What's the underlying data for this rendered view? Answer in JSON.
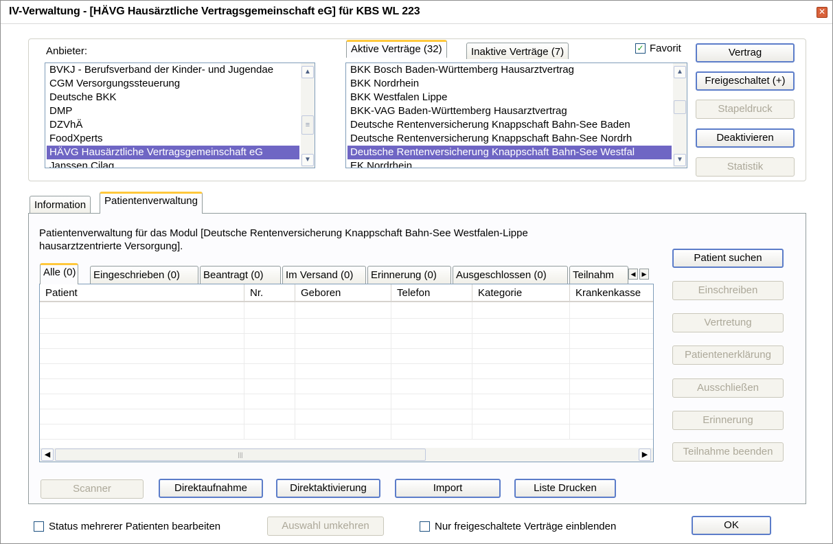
{
  "window": {
    "title": "IV-Verwaltung - [HÄVG Hausärztliche Vertragsgemeinschaft eG] für KBS WL 223",
    "close_glyph": "✕"
  },
  "anbieter": {
    "label": "Anbieter:",
    "items": [
      "BVKJ - Berufsverband der Kinder- und Jugendae",
      "CGM Versorgungssteuerung",
      "Deutsche BKK",
      "DMP",
      "DZVhÄ",
      "FoodXperts",
      "HÄVG Hausärztliche Vertragsgemeinschaft eG",
      "Janssen Cilag"
    ],
    "selected_index": 6
  },
  "vertraege_tabs": {
    "aktive": "Aktive Verträge (32)",
    "inaktive": "Inaktive Verträge (7)"
  },
  "favorit": {
    "label": "Favorit",
    "checked": true,
    "check_glyph": "✓"
  },
  "vertraege": {
    "items": [
      "BKK Bosch Baden-Württemberg Hausarztvertrag",
      "BKK Nordrhein",
      "BKK Westfalen Lippe",
      "BKK-VAG Baden-Württemberg Hausarztvertrag",
      "Deutsche Rentenversicherung Knappschaft Bahn-See Baden",
      "Deutsche Rentenversicherung Knappschaft Bahn-See Nordrh",
      "Deutsche Rentenversicherung Knappschaft Bahn-See Westfal",
      "EK Nordrhein"
    ],
    "selected_index": 6
  },
  "side_buttons_top": {
    "vertrag": "Vertrag",
    "freigeschaltet": "Freigeschaltet (+)",
    "stapeldruck": "Stapeldruck",
    "deaktivieren": "Deaktivieren",
    "statistik": "Statistik"
  },
  "main_tabs": {
    "information": "Information",
    "patientenverwaltung": "Patientenverwaltung"
  },
  "patient_panel": {
    "description_line1": "Patientenverwaltung für das Modul [Deutsche Rentenversicherung Knappschaft Bahn-See Westfalen-Lippe",
    "description_line2": "hausarztzentrierte Versorgung].",
    "status_tabs": [
      "Alle (0)",
      "Eingeschrieben (0)",
      "Beantragt (0)",
      "Im Versand (0)",
      "Erinnerung (0)",
      "Ausgeschlossen (0)",
      "Teilnahm"
    ],
    "columns": [
      "Patient",
      "Nr.",
      "Geboren",
      "Telefon",
      "Kategorie",
      "Krankenkasse"
    ]
  },
  "side_buttons_patient": {
    "patient_suchen": "Patient suchen",
    "einschreiben": "Einschreiben",
    "vertretung": "Vertretung",
    "patientenerklaerung": "Patientenerklärung",
    "ausschliessen": "Ausschließen",
    "erinnerung": "Erinnerung",
    "teilnahme_beenden": "Teilnahme beenden"
  },
  "bottom_buttons": {
    "scanner": "Scanner",
    "direktaufnahme": "Direktaufnahme",
    "direktaktivierung": "Direktaktivierung",
    "import": "Import",
    "liste_drucken": "Liste Drucken"
  },
  "footer": {
    "status_mehrerer": "Status mehrerer Patienten bearbeiten",
    "auswahl_umkehren": "Auswahl umkehren",
    "nur_freigeschaltete": "Nur freigeschaltete Verträge einblenden",
    "ok": "OK"
  },
  "glyphs": {
    "up": "▲",
    "down": "▼",
    "left": "◀",
    "right": "▶",
    "grip": "≡",
    "grip_h": "|||"
  }
}
